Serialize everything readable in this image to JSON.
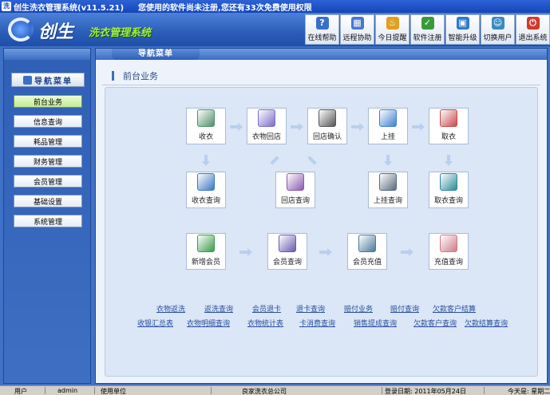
{
  "window": {
    "title": "创生洗衣管理系统(v11.5.21)",
    "notice": "您使用的软件尚未注册,您还有33次免费使用权限"
  },
  "header": {
    "brand": "创生",
    "subtitle": "洗衣管理系统"
  },
  "toolbar": [
    {
      "label": "在线帮助",
      "icon": "help-icon",
      "glyph": "?",
      "color": "#3a6fd0"
    },
    {
      "label": "远程协助",
      "icon": "remote-icon",
      "glyph": "▦",
      "color": "#4a78c8"
    },
    {
      "label": "今日提醒",
      "icon": "reminder-icon",
      "glyph": "♨",
      "color": "#e0a020"
    },
    {
      "label": "软件注册",
      "icon": "register-icon",
      "glyph": "✓",
      "color": "#3a9a3a"
    },
    {
      "label": "智能升级",
      "icon": "upgrade-icon",
      "glyph": "▣",
      "color": "#2f7ac8"
    },
    {
      "label": "切换用户",
      "icon": "switch-user-icon",
      "glyph": "☺",
      "color": "#3a8ac0"
    },
    {
      "label": "退出系统",
      "icon": "exit-icon",
      "glyph": "⏻",
      "color": "#d03a2a"
    }
  ],
  "sidebar": {
    "heading": "导航菜单",
    "items": [
      {
        "label": "前台业务",
        "active": true
      },
      {
        "label": "信息查询",
        "active": false
      },
      {
        "label": "耗品管理",
        "active": false
      },
      {
        "label": "财务管理",
        "active": false
      },
      {
        "label": "会员管理",
        "active": false
      },
      {
        "label": "基础设置",
        "active": false
      },
      {
        "label": "系统管理",
        "active": false
      }
    ]
  },
  "content": {
    "tab": "导航菜单",
    "section_title": "前台业务"
  },
  "flow": {
    "receive": {
      "label": "收衣",
      "icon": "shirt-icon",
      "color": "#4f8f6a"
    },
    "return_to_store": {
      "label": "衣物回店",
      "icon": "notebook-icon",
      "color": "#7a6cc8"
    },
    "return_confirm": {
      "label": "回店确认",
      "icon": "list-icon",
      "color": "#555555"
    },
    "hang": {
      "label": "上挂",
      "icon": "tablet-icon",
      "color": "#3f7fd0"
    },
    "pickup": {
      "label": "取衣",
      "icon": "certificate-icon",
      "color": "#c84a4a"
    },
    "receive_query": {
      "label": "收衣查询",
      "icon": "books-icon",
      "color": "#3a78c0"
    },
    "return_query": {
      "label": "回店查询",
      "icon": "search-books-icon",
      "color": "#8a5ab0"
    },
    "hang_query": {
      "label": "上挂查询",
      "icon": "magnifier-icon",
      "color": "#5a6a80"
    },
    "pickup_query": {
      "label": "取衣查询",
      "icon": "pickup-query-icon",
      "color": "#2a8a9a"
    },
    "new_member": {
      "label": "新增会员",
      "icon": "users-icon",
      "color": "#3a9a4a"
    },
    "member_query": {
      "label": "会员查询",
      "icon": "member-search-icon",
      "color": "#6a5ab0"
    },
    "member_recharge": {
      "label": "会员充值",
      "icon": "card-icon",
      "color": "#4a7a9a"
    },
    "recharge_query": {
      "label": "充值查询",
      "icon": "money-icon",
      "color": "#d07a8a"
    }
  },
  "quick_links": {
    "row1": [
      "衣物返洗",
      "返洗查询",
      "会员退卡",
      "退卡查询",
      "赔付业务",
      "赔付查询",
      "欠款客户结算"
    ],
    "row2": [
      "收银汇总表",
      "衣物明细查询",
      "衣物统计表",
      "卡消费查询",
      "销售提成查询",
      "欠款客户查询",
      "欠款结算查询"
    ]
  },
  "status": {
    "user_label": "用户",
    "user_value": "admin",
    "unit_label": "使用单位",
    "company": "良家洗衣总公司",
    "login_date": "登录日期: 2011年05月24日",
    "today": "今天是: 星期二"
  }
}
